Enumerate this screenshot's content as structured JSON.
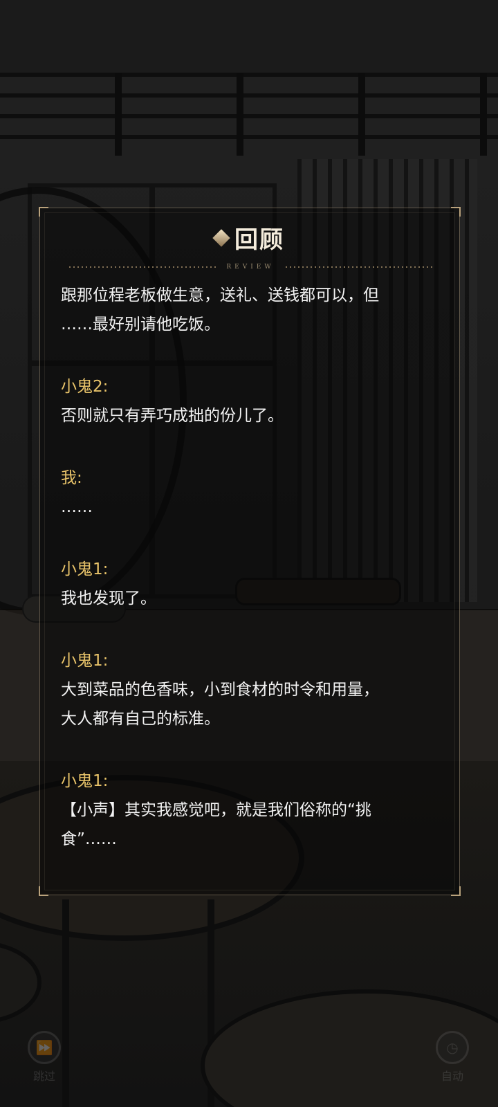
{
  "review": {
    "title": "回顾",
    "subtitle": "REVIEW",
    "entries": [
      {
        "speaker": "",
        "lines": [
          "跟那位程老板做生意，送礼、送钱都可以，但",
          "……最好别请他吃饭。"
        ]
      },
      {
        "speaker": "小鬼2:",
        "lines": [
          "否则就只有弄巧成拙的份儿了。"
        ]
      },
      {
        "speaker": "我:",
        "lines": [
          "……"
        ]
      },
      {
        "speaker": "小鬼1:",
        "lines": [
          "我也发现了。"
        ]
      },
      {
        "speaker": "小鬼1:",
        "lines": [
          "大到菜品的色香味，小到食材的时令和用量，",
          "大人都有自己的标准。"
        ]
      },
      {
        "speaker": "小鬼1:",
        "lines": [
          "【小声】其实我感觉吧，就是我们俗称的“挑",
          "食”……"
        ]
      }
    ]
  },
  "controls": {
    "skip_label": "跳过",
    "auto_label": "自动"
  },
  "colors": {
    "speaker": "#e9c46a",
    "text": "#f3f3f3",
    "panel_border": "#b9a27c"
  }
}
